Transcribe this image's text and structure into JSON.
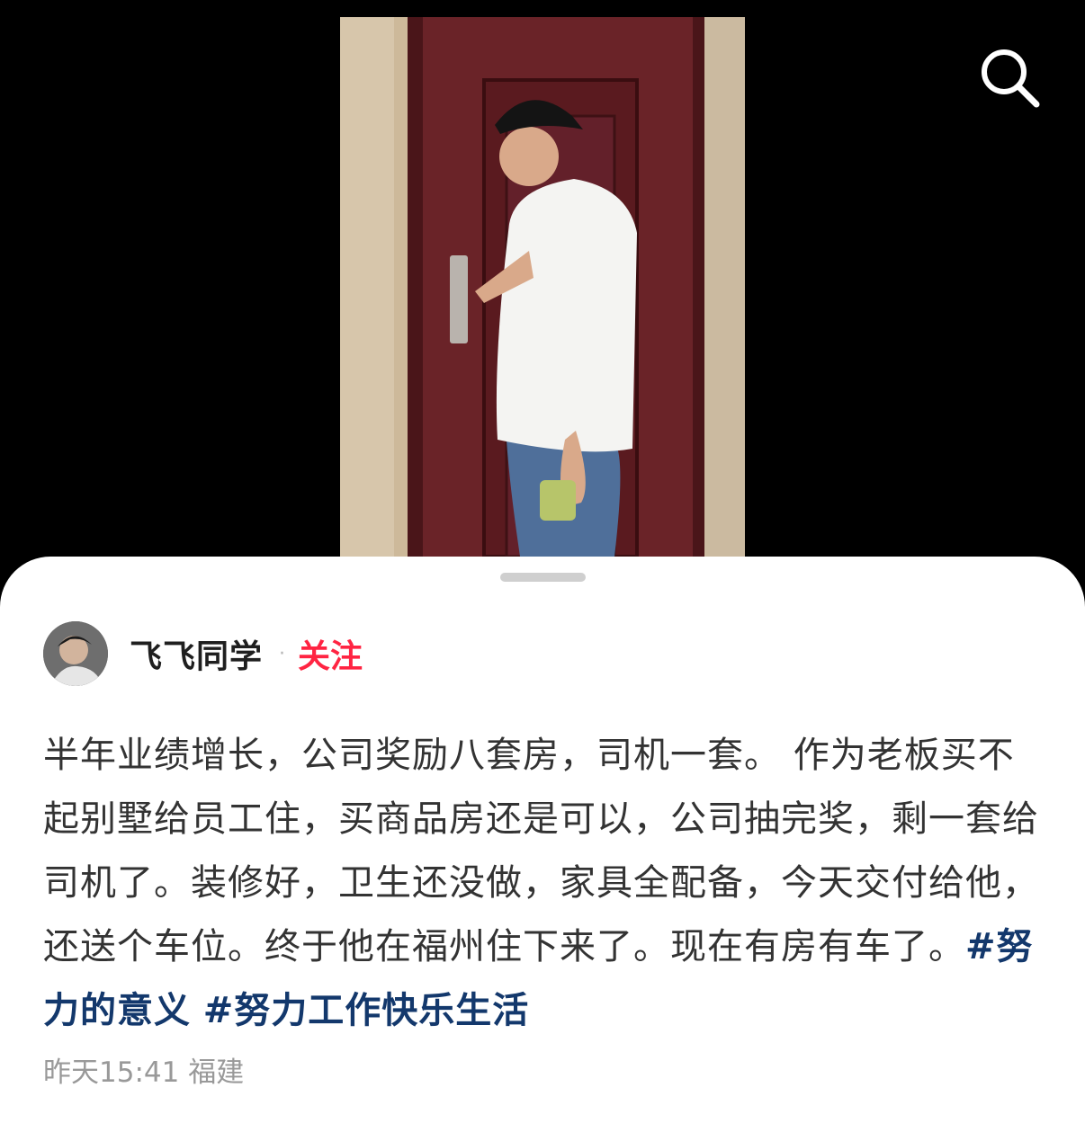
{
  "post": {
    "author": "飞飞同学",
    "separator": "·",
    "follow_label": "关注",
    "text": "半年业绩增长，公司奖励八套房，司机一套。 作为老板买不起别墅给员工住，买商品房还是可以，公司抽完奖，剩一套给司机了。装修好，卫生还没做，家具全配备，今天交付给他，还送个车位。终于他在福州住下来了。现在有房有车了。",
    "hashtags": [
      "#努力的意义",
      "#努力工作快乐生活"
    ],
    "time": "昨天15:41",
    "location": "福建"
  },
  "icons": {
    "search": "search-icon"
  },
  "colors": {
    "follow": "#ff2442",
    "hashtag": "#13386c",
    "meta": "#999999"
  }
}
